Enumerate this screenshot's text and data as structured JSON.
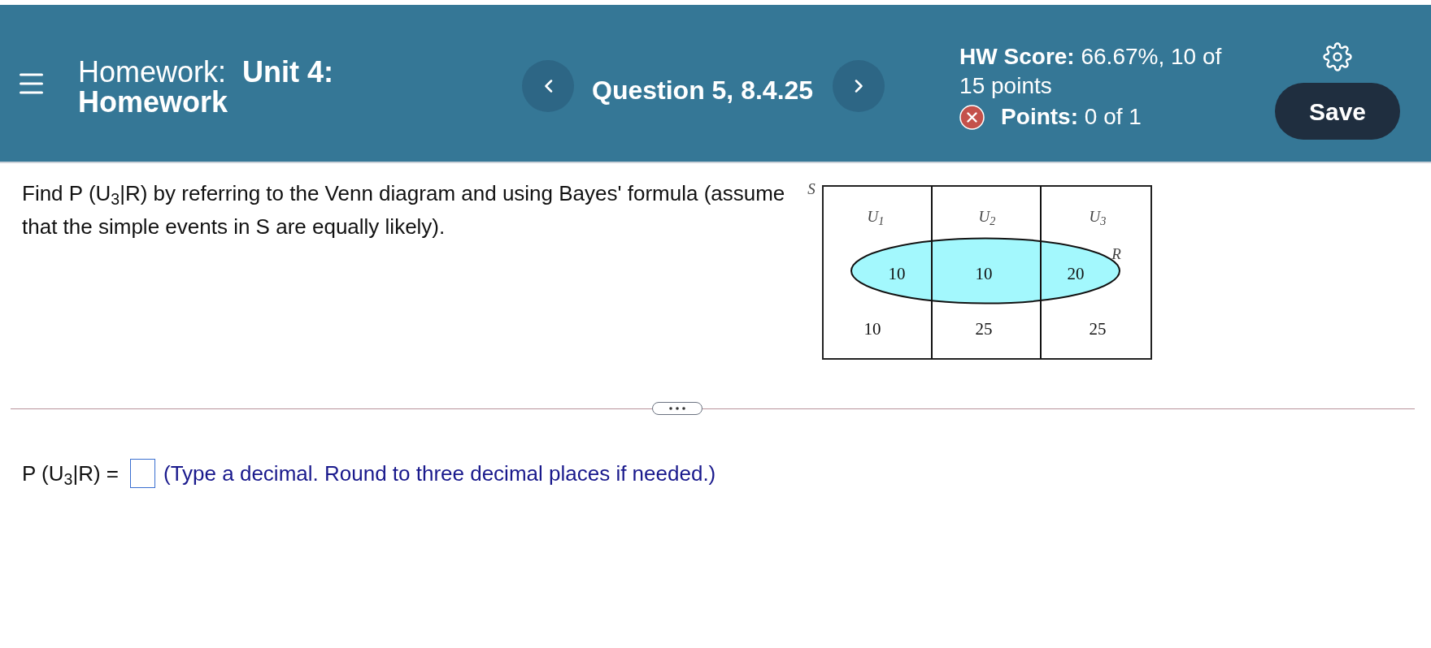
{
  "header": {
    "title": "Homework:  **Unit 4: Homework**",
    "question_label": "Question 5, 8.4.25",
    "hw_score": "**HW Score:** 66.67%, 10 of 15 points",
    "points": {
      "text": "**Points:** 0 of 1",
      "correct": false
    },
    "save_button": "Save"
  },
  "question": {
    "text": "Find P (U$_{3}$|R) by referring to the Venn diagram and using Bayes' formula (assume that the simple events in S are equally likely)."
  },
  "venn_diagram": {
    "universe_label": "S",
    "event_label": "R",
    "columns": [
      {
        "label": "U$_{1}$",
        "in_event": "10",
        "outside_event": "10"
      },
      {
        "label": "U$_{2}$",
        "in_event": "10",
        "outside_event": "25"
      },
      {
        "label": "U$_{3}$",
        "in_event": "20",
        "outside_event": "25"
      }
    ]
  },
  "answer": {
    "prompt": "P (U$_{3}$|R) =",
    "hint": "(Type a decimal. Round to three decimal places if needed.)"
  }
}
